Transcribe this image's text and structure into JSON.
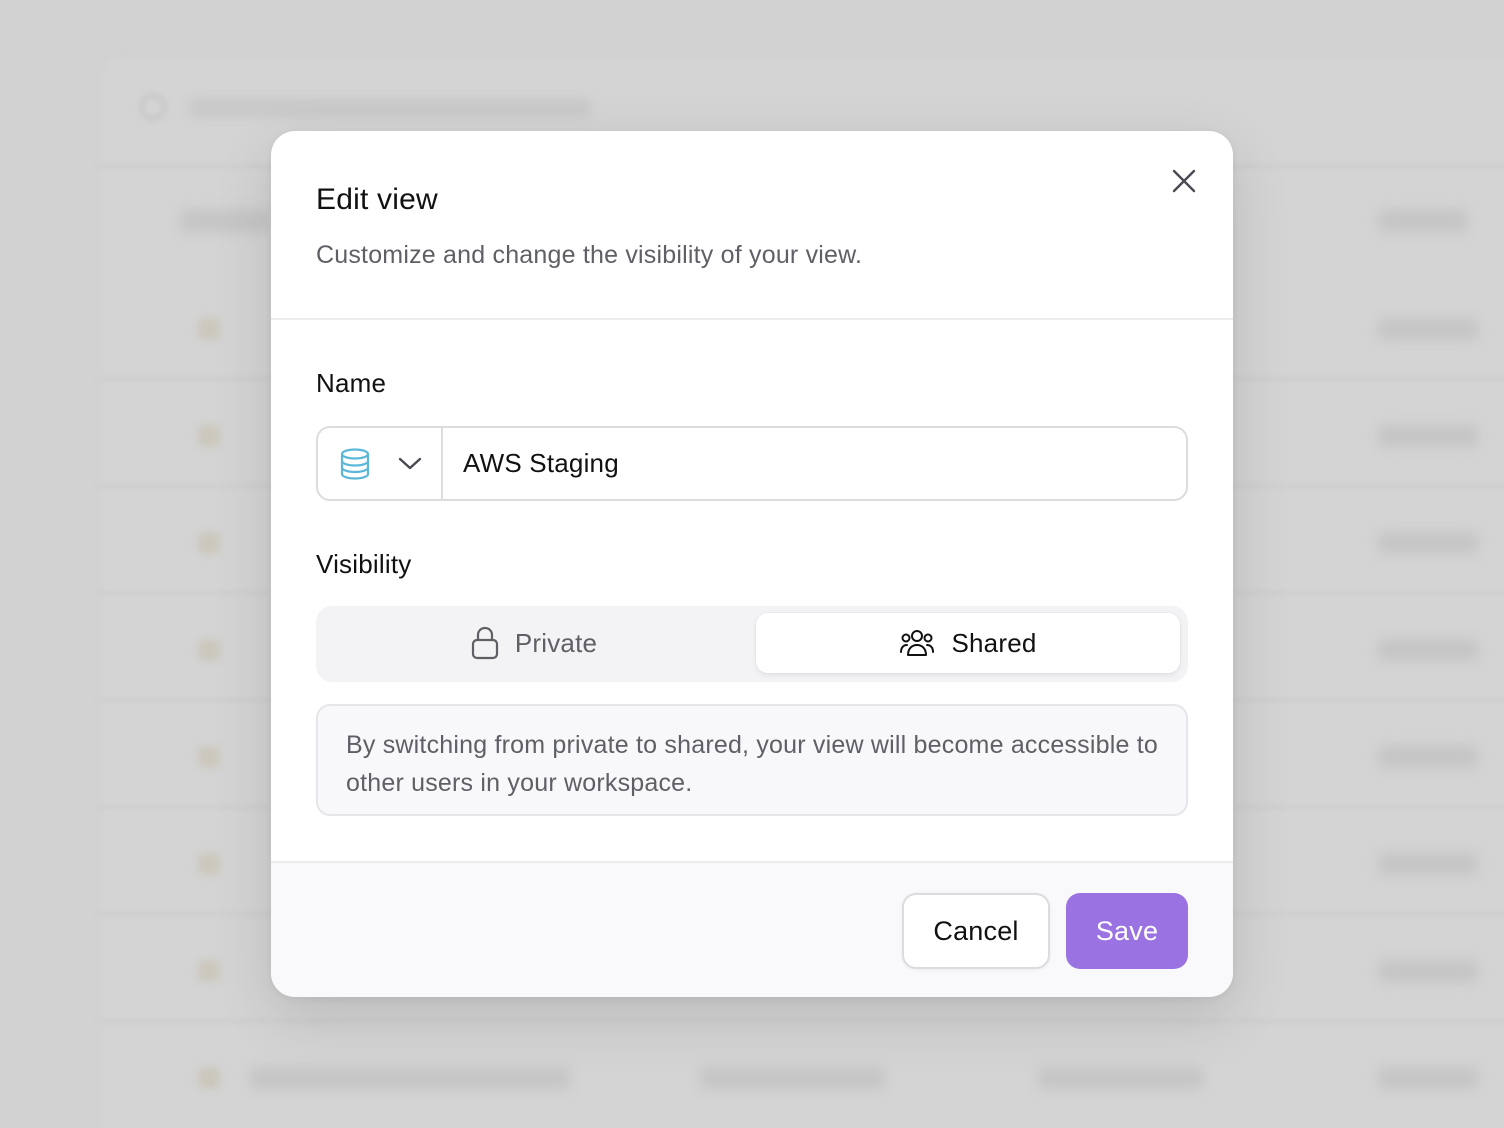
{
  "modal": {
    "title": "Edit view",
    "subtitle": "Customize and change the visibility of your view.",
    "close_icon": "close-icon"
  },
  "name_field": {
    "label": "Name",
    "value": "AWS Staging",
    "icon": "database-icon",
    "icon_color": "#5bb8d8",
    "dropdown_icon": "chevron-down-icon"
  },
  "visibility": {
    "label": "Visibility",
    "options": [
      {
        "label": "Private",
        "icon": "lock-icon",
        "selected": false
      },
      {
        "label": "Shared",
        "icon": "users-icon",
        "selected": true
      }
    ],
    "info": "By switching from private to shared, your view will become accessible to other users in your workspace."
  },
  "footer": {
    "cancel_label": "Cancel",
    "save_label": "Save"
  },
  "colors": {
    "accent": "#9b72e2",
    "backdrop": "#d2d2d2"
  }
}
